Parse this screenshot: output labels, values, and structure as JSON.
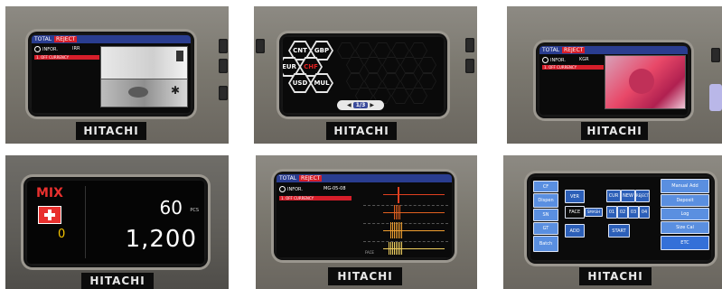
{
  "brand": "HITACHI",
  "panel1": {
    "header_total": "TOTAL",
    "header_reject": "REJECT",
    "infor": "INFOR.",
    "currency": "IRR",
    "alert": "1. OFF CURRENCY"
  },
  "panel2": {
    "currencies": [
      "CNT",
      "GBP",
      "EUR",
      "CHF",
      "USD",
      "MUL"
    ],
    "selected": "CHF",
    "page": "1/3",
    "selected_color": "#e02020"
  },
  "panel3": {
    "header_total": "TOTAL",
    "header_reject": "REJECT",
    "infor": "INFOR.",
    "currency": "KGR",
    "alert": "1. OFF CURRENCY"
  },
  "panel4": {
    "mode": "MIX",
    "batch_count": "0",
    "pcs_value": "60",
    "pcs_unit": "PCS",
    "total": "1,200",
    "mode_color": "#e8302e",
    "count_color": "#f4c400"
  },
  "panel5": {
    "header_total": "TOTAL",
    "header_reject": "REJECT",
    "infor": "INFOR.",
    "code": "MG-05-08",
    "alert": "1. OFF CURRENCY",
    "face_label": "FACE"
  },
  "panel6": {
    "left_buttons": [
      "CF",
      "Dispen",
      "SN",
      "GT",
      "Batch"
    ],
    "center_buttons": [
      "VER",
      "FACE",
      "ADD"
    ],
    "center_mini": "SMASH",
    "top_small": [
      "CUR",
      "NEW",
      "REJECT"
    ],
    "mid_small": [
      "01",
      "02",
      "03",
      "04"
    ],
    "start": "START",
    "right_buttons": [
      "Manual Add",
      "Deposit",
      "Log",
      "Size Cal",
      "ETC"
    ]
  }
}
